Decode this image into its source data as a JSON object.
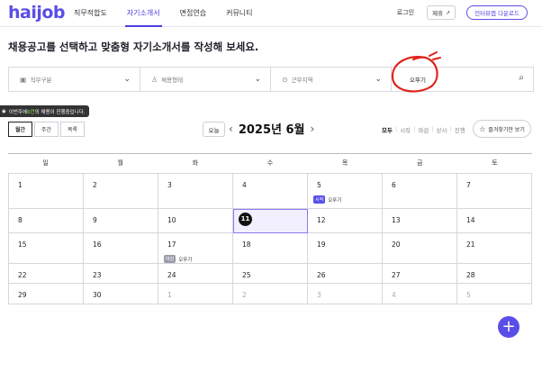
{
  "brand": {
    "logo": "haijob"
  },
  "nav": [
    {
      "label": "직무적합도",
      "active": false
    },
    {
      "label": "자기소개서",
      "active": true
    },
    {
      "label": "면접연습",
      "active": false
    },
    {
      "label": "커뮤니티",
      "active": false
    }
  ],
  "topbar": {
    "login": "로그인",
    "signup": "제휴",
    "download": "인터뷰앱 다운로드"
  },
  "headline": "채용공고를 선택하고 맞춤형 자기소개서를 작성해 보세요.",
  "filters": {
    "job": "직무구분",
    "employment": "채용형태",
    "location": "근무지역",
    "search_value": "오뚜기"
  },
  "tooltip": {
    "prefix": "이번주에 ",
    "highlight": "0건",
    "suffix": "의 채용이 진행중입니다."
  },
  "view_tabs": [
    "월간",
    "주간",
    "목록"
  ],
  "today_label": "오늘",
  "month_title": "2025년 6월",
  "status_filter": [
    {
      "label": "모두",
      "active": true
    },
    {
      "label": "시작",
      "active": false
    },
    {
      "label": "마감",
      "active": false
    },
    {
      "label": "상시",
      "active": false
    },
    {
      "label": "진행",
      "active": false
    }
  ],
  "favorite_label": "즐겨찾기만 보기",
  "weekdays": [
    "일",
    "월",
    "화",
    "수",
    "목",
    "금",
    "토"
  ],
  "weeks": [
    [
      {
        "d": "1"
      },
      {
        "d": "2"
      },
      {
        "d": "3"
      },
      {
        "d": "4"
      },
      {
        "d": "5",
        "event": {
          "badge": "시작",
          "type": "start",
          "label": "오뚜기"
        }
      },
      {
        "d": "6"
      },
      {
        "d": "7"
      }
    ],
    [
      {
        "d": "8"
      },
      {
        "d": "9"
      },
      {
        "d": "10"
      },
      {
        "d": "11",
        "today": true
      },
      {
        "d": "12"
      },
      {
        "d": "13"
      },
      {
        "d": "14"
      }
    ],
    [
      {
        "d": "15"
      },
      {
        "d": "16"
      },
      {
        "d": "17",
        "event": {
          "badge": "마감",
          "type": "end",
          "label": "오뚜기"
        }
      },
      {
        "d": "18"
      },
      {
        "d": "19"
      },
      {
        "d": "20"
      },
      {
        "d": "21"
      }
    ],
    [
      {
        "d": "22"
      },
      {
        "d": "23"
      },
      {
        "d": "24"
      },
      {
        "d": "25"
      },
      {
        "d": "26"
      },
      {
        "d": "27"
      },
      {
        "d": "28"
      }
    ],
    [
      {
        "d": "29"
      },
      {
        "d": "30"
      },
      {
        "d": "1",
        "muted": true
      },
      {
        "d": "2",
        "muted": true
      },
      {
        "d": "3",
        "muted": true
      },
      {
        "d": "4",
        "muted": true
      },
      {
        "d": "5",
        "muted": true
      }
    ]
  ],
  "fab": "+",
  "colors": {
    "accent": "#5a4ee8",
    "annotation": "#e0231b"
  }
}
